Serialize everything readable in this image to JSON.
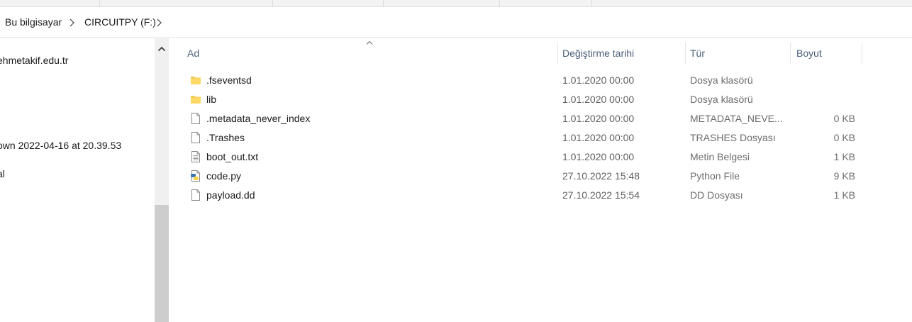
{
  "breadcrumb": {
    "items": [
      "Bu bilgisayar",
      "CIRCUITPY (F:)"
    ]
  },
  "nav_pane": {
    "items": [
      "ehmetakif.edu.tr",
      "own 2022-04-16 at 20.39.53",
      "al"
    ]
  },
  "columns": {
    "name": "Ad",
    "modified": "Değiştirme tarihi",
    "type": "Tür",
    "size": "Boyut"
  },
  "files": [
    {
      "name": ".fseventsd",
      "modified": "1.01.2020 00:00",
      "type": "Dosya klasörü",
      "size": "",
      "icon": "folder-icon"
    },
    {
      "name": "lib",
      "modified": "1.01.2020 00:00",
      "type": "Dosya klasörü",
      "size": "",
      "icon": "folder-icon"
    },
    {
      "name": ".metadata_never_index",
      "modified": "1.01.2020 00:00",
      "type": "METADATA_NEVE...",
      "size": "0 KB",
      "icon": "file-icon"
    },
    {
      "name": ".Trashes",
      "modified": "1.01.2020 00:00",
      "type": "TRASHES Dosyası",
      "size": "0 KB",
      "icon": "file-icon"
    },
    {
      "name": "boot_out.txt",
      "modified": "1.01.2020 00:00",
      "type": "Metin Belgesi",
      "size": "1 KB",
      "icon": "text-file-icon"
    },
    {
      "name": "code.py",
      "modified": "27.10.2022 15:48",
      "type": "Python File",
      "size": "9 KB",
      "icon": "python-file-icon"
    },
    {
      "name": "payload.dd",
      "modified": "27.10.2022 15:54",
      "type": "DD Dosyası",
      "size": "1 KB",
      "icon": "file-icon"
    }
  ],
  "colors": {
    "header_text": "#4c607a",
    "folder": "#f3c74f",
    "python_blue": "#3a74b3",
    "python_yellow": "#f7d44a"
  }
}
